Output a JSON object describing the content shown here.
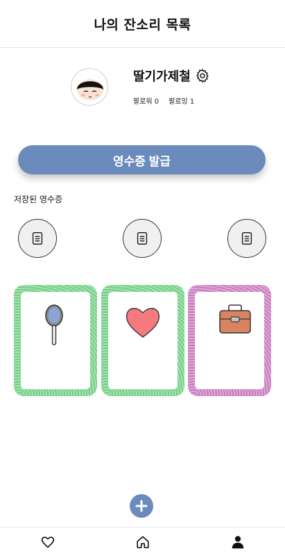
{
  "header": {
    "title": "나의 잔소리 목록"
  },
  "profile": {
    "nickname": "딸기가제철",
    "followers": "팔로워 0",
    "following": "팔로잉 1"
  },
  "issue_button": {
    "label": "영수증 발급"
  },
  "saved_section": {
    "label": "저장된 영수증"
  },
  "receipts": [
    {
      "icon": "document-icon"
    },
    {
      "icon": "document-icon"
    },
    {
      "icon": "document-icon"
    }
  ],
  "cards": [
    {
      "theme": "green",
      "icon": "hand-mirror-icon"
    },
    {
      "theme": "green",
      "icon": "heart-icon"
    },
    {
      "theme": "pink",
      "icon": "briefcase-icon"
    }
  ],
  "colors": {
    "accent": "#6b8bbd",
    "card_green": "#74cf86",
    "card_pink": "#c87cbf"
  },
  "tabbar": {
    "items": [
      {
        "icon": "heart-icon"
      },
      {
        "icon": "home-icon"
      },
      {
        "icon": "person-icon",
        "active": true
      }
    ]
  }
}
